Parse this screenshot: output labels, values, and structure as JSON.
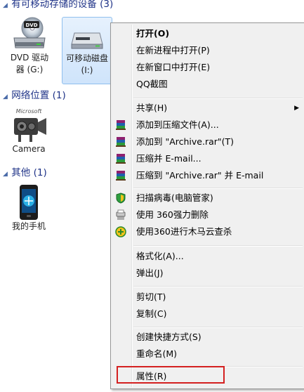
{
  "groups": {
    "removable": {
      "title": "有可移动存储的设备 (3)"
    },
    "network": {
      "title": "网络位置 (1)"
    },
    "other": {
      "title": "其他 (1)"
    }
  },
  "devices": {
    "dvd": {
      "line1": "DVD 驱动",
      "line2": "器 (G:)"
    },
    "removable_disk": {
      "line1": "可移动磁盘",
      "line2": "(I:)"
    },
    "camera": {
      "line1": "Camera",
      "logo_text": "Microsoft"
    },
    "phone": {
      "line1": "我的手机"
    }
  },
  "menu": {
    "items": [
      {
        "label": "打开(O)",
        "bold": true
      },
      {
        "label": "在新进程中打开(P)"
      },
      {
        "label": "在新窗口中打开(E)"
      },
      {
        "label": "QQ截图"
      },
      {
        "label": "共享(H)",
        "submenu": true
      },
      {
        "label": "添加到压缩文件(A)...",
        "icon": "winrar-icon"
      },
      {
        "label": "添加到 \"Archive.rar\"(T)",
        "icon": "winrar-icon"
      },
      {
        "label": "压缩并 E-mail...",
        "icon": "winrar-icon"
      },
      {
        "label": "压缩到 \"Archive.rar\" 并 E-mail",
        "icon": "winrar-icon"
      },
      {
        "label": "扫描病毒(电脑管家)",
        "icon": "shield-icon"
      },
      {
        "label": "使用 360强力删除",
        "icon": "shredder-icon"
      },
      {
        "label": "使用360进行木马云查杀",
        "icon": "360-icon"
      },
      {
        "label": "格式化(A)..."
      },
      {
        "label": "弹出(J)"
      },
      {
        "label": "剪切(T)"
      },
      {
        "label": "复制(C)"
      },
      {
        "label": "创建快捷方式(S)"
      },
      {
        "label": "重命名(M)"
      },
      {
        "label": "属性(R)"
      }
    ]
  },
  "colors": {
    "group_header": "#1e3287",
    "menu_bg": "#f0f0f0",
    "highlight_border": "#d42020"
  }
}
